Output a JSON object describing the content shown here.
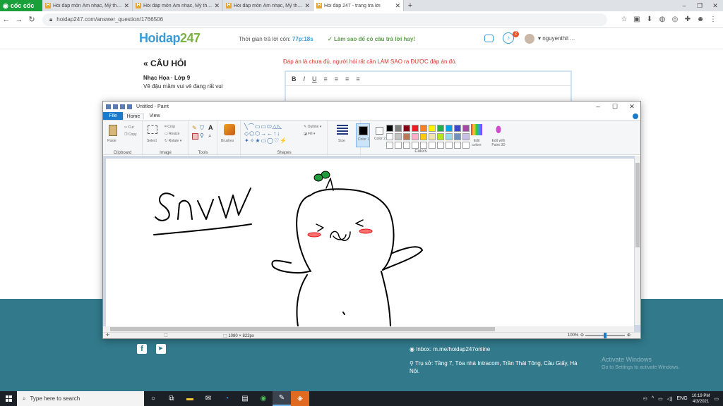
{
  "browser": {
    "brand": "cốc cốc",
    "tabs": [
      {
        "label": "Hỏi đáp môn Âm nhạc, Mỹ thuật"
      },
      {
        "label": "Hỏi đáp môn Âm nhạc, Mỹ thuật"
      },
      {
        "label": "Hỏi đáp môn Âm nhạc, Mỹ thuật"
      },
      {
        "label": "Hỏi đáp 247 - trang tra lời"
      }
    ],
    "url": "hoidap247.com/answer_question/1766506"
  },
  "site": {
    "logo_text": "Hoidap",
    "logo_num": "247",
    "timer_prefix": "Thời gian trả lời còn:",
    "timer_value": "77p:18s",
    "howto": "Làm sao để có câu trả lời hay!",
    "notif_count": "2",
    "username": "nguyenthit ..."
  },
  "question": {
    "title": "« CÂU HỎI",
    "subject": "Nhạc Họa · Lớp 9",
    "text": "Vẽ đậu mầm vui vẻ đang rất vui"
  },
  "answer": {
    "warning": "Đáp án là chưa đủ, người hỏi rất cần LÀM SAO ra ĐƯỢC đáp án đó.",
    "toolbar": [
      "B",
      "I",
      "U",
      "≡",
      "≡",
      "≡",
      "≡"
    ]
  },
  "footer": {
    "inbox": "Inbox: m.me/hoidap247online",
    "address": "Trụ sở: Tầng 7, Tòa nhà Intracom, Trần Thái Tông, Cầu Giấy, Hà Nội.",
    "activate_title": "Activate Windows",
    "activate_sub": "Go to Settings to activate Windows."
  },
  "paint": {
    "title": "Untitled - Paint",
    "tabs": {
      "file": "File",
      "home": "Home",
      "view": "View"
    },
    "groups": {
      "clipboard": "Clipboard",
      "image": "Image",
      "tools": "Tools",
      "shapes": "Shapes",
      "colors": "Colors"
    },
    "buttons": {
      "paste": "Paste",
      "cut": "Cut",
      "copy": "Copy",
      "select": "Select",
      "crop": "Crop",
      "resize": "Resize",
      "rotate": "Rotate",
      "brushes": "Brushes",
      "outline": "Outline",
      "fill": "Fill",
      "size": "Size",
      "color1": "Color 1",
      "color2": "Color 2",
      "edit_colors": "Edit colors",
      "edit_3d": "Edit with Paint 3D"
    },
    "palette": [
      "#000000",
      "#7f7f7f",
      "#880015",
      "#ed1c24",
      "#ff7f27",
      "#fff200",
      "#22b14c",
      "#00a2e8",
      "#3f48cc",
      "#a349a4",
      "#ffffff",
      "#c3c3c3",
      "#b97a57",
      "#ffaec9",
      "#ffc90e",
      "#efe4b0",
      "#b5e61d",
      "#99d9ea",
      "#7092be",
      "#c8bfe7",
      "#ffffff",
      "#ffffff",
      "#ffffff",
      "#ffffff",
      "#ffffff",
      "#ffffff",
      "#ffffff",
      "#ffffff",
      "#ffffff",
      "#ffffff"
    ],
    "drawing_text": "SnVV",
    "dimensions": "1080 × 822px",
    "zoom": "100%"
  },
  "taskbar": {
    "search_placeholder": "Type here to search",
    "lang": "ENG",
    "time": "10:19 PM",
    "date": "4/3/2021"
  }
}
